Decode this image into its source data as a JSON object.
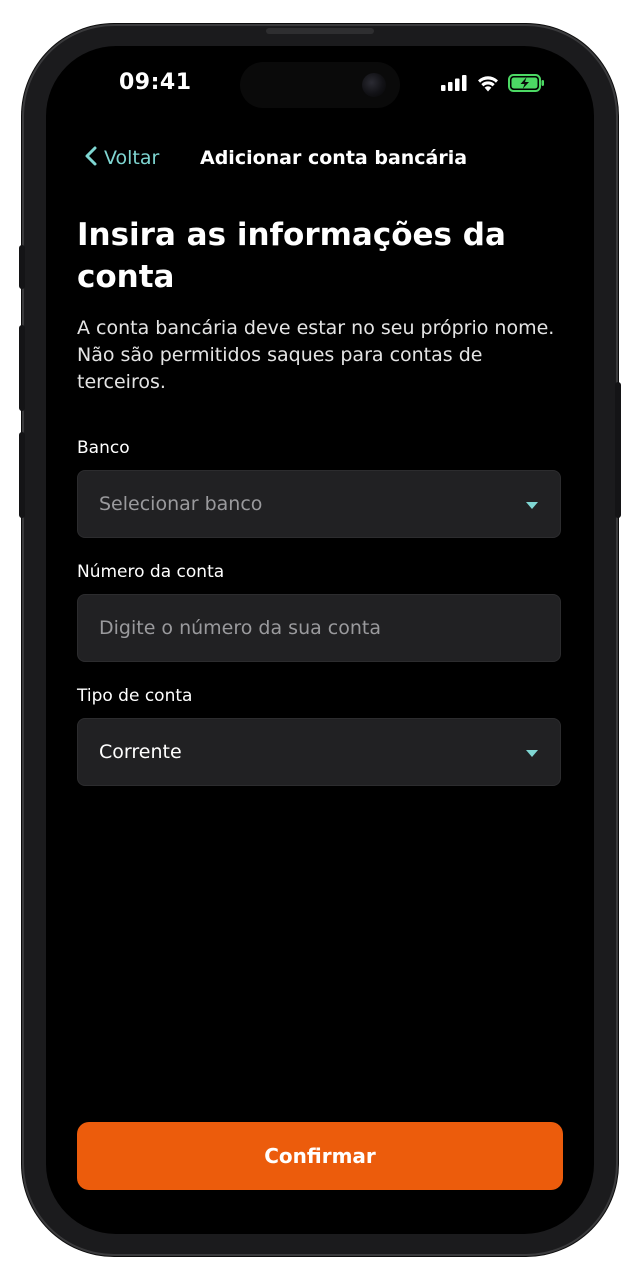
{
  "status_bar": {
    "time": "09:41",
    "icons": [
      "cellular-signal-icon",
      "wifi-icon",
      "battery-charging-icon"
    ],
    "battery_color": "#4cd964"
  },
  "nav": {
    "back_label": "Voltar",
    "title": "Adicionar conta bancária"
  },
  "heading": {
    "title": "Insira as informações da conta",
    "description": "A conta bancária deve estar no seu próprio nome. Não são permitidos saques para contas de terceiros."
  },
  "form": {
    "bank": {
      "label": "Banco",
      "placeholder": "Selecionar banco"
    },
    "account_number": {
      "label": "Número da conta",
      "placeholder": "Digite o número da sua conta",
      "value": ""
    },
    "account_type": {
      "label": "Tipo de conta",
      "selected": "Corrente"
    }
  },
  "actions": {
    "confirm_label": "Confirmar"
  },
  "colors": {
    "accent": "#7fd6d2",
    "primary_button": "#ec5c0c",
    "background": "#000000",
    "field_background": "#212123"
  }
}
